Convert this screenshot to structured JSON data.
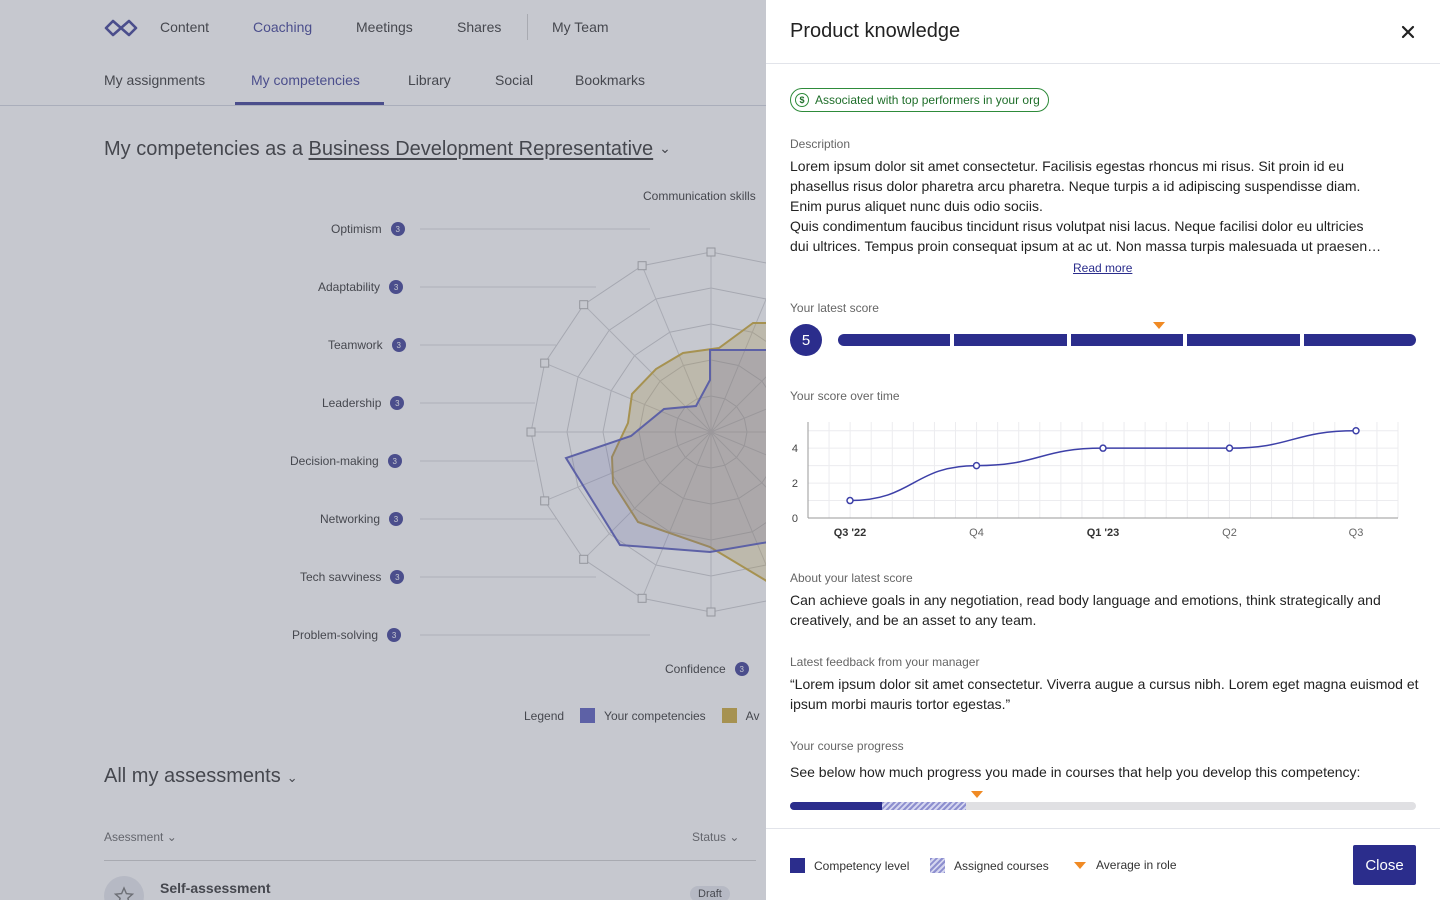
{
  "topnav": {
    "items": [
      "Content",
      "Coaching",
      "Meetings",
      "Shares",
      "My Team"
    ],
    "active": "Coaching"
  },
  "subnav": {
    "items": [
      "My assignments",
      "My competencies",
      "Library",
      "Social",
      "Bookmarks"
    ],
    "active": "My competencies"
  },
  "page": {
    "heading_prefix": "My competencies as a ",
    "role": "Business Development Representative"
  },
  "radar": {
    "competencies": [
      {
        "label": "Communication skills"
      },
      {
        "label": "Optimism",
        "badge": "3"
      },
      {
        "label": "Adaptability",
        "badge": "3"
      },
      {
        "label": "Teamwork",
        "badge": "3"
      },
      {
        "label": "Leadership",
        "badge": "3"
      },
      {
        "label": "Decision-making",
        "badge": "3"
      },
      {
        "label": "Networking",
        "badge": "3"
      },
      {
        "label": "Tech savviness",
        "badge": "3"
      },
      {
        "label": "Problem-solving",
        "badge": "3"
      },
      {
        "label": "Confidence",
        "badge": "3"
      }
    ],
    "legend_title": "Legend",
    "legend_items": [
      {
        "label": "Your competencies",
        "color": "#4b4fb8"
      },
      {
        "label": "Av",
        "color": "#c9a227"
      }
    ]
  },
  "assessments": {
    "heading": "All my assessments",
    "col_assessment": "Asessment",
    "col_status": "Status",
    "rows": [
      {
        "title": "Self-assessment",
        "status": "Draft"
      }
    ]
  },
  "drawer": {
    "title": "Product knowledge",
    "badge": "Associated with top performers in your org",
    "description_label": "Description",
    "description_lines": [
      "Lorem ipsum dolor sit amet consectetur. Facilisis egestas rhoncus mi risus. Sit proin id eu",
      "phasellus risus dolor pharetra arcu pharetra. Neque turpis a id adipiscing suspendisse diam.",
      "Enim purus aliquet nunc duis odio sociis.",
      "Quis condimentum faucibus tincidunt risus volutpat nisi lacus. Neque facilisi dolor eu ultricies",
      "dui ultrices. Tempus proin consequat ipsum at ac ut. Non massa turpis malesuada ut praesen…"
    ],
    "read_more": "Read more",
    "latest_score_label": "Your latest score",
    "latest_score": "5",
    "score_max_segments": 5,
    "average_marker_fraction": 0.555,
    "over_time_label": "Your score over time",
    "about_label": "About your latest score",
    "about_text": "Can achieve goals in any negotiation, read body language and emotions, think strategically and creatively, and be an asset to any team.",
    "feedback_label": "Latest feedback from your manager",
    "feedback_text": "“Lorem ipsum dolor sit amet consectetur. Viverra augue a cursus nibh. Lorem eget magna euismod et ipsum morbi mauris tortor egestas.”",
    "progress_label": "Your course progress",
    "progress_text": "See below how much progress you made in courses that help you develop this competency:",
    "progress": {
      "competency_level": 0.147,
      "assigned_courses_end": 0.281,
      "average_in_role": 0.298
    },
    "footer_legend": {
      "competency_level": "Competency level",
      "assigned_courses": "Assigned courses",
      "average_in_role": "Average in role"
    },
    "close_label": "Close"
  },
  "chart_data": {
    "type": "line",
    "title": "",
    "xlabel": "",
    "ylabel": "",
    "categories": [
      "Q3 '22",
      "Q4",
      "Q1 '23",
      "Q2",
      "Q3"
    ],
    "bold_categories": [
      "Q3 '22",
      "Q1 '23"
    ],
    "values": [
      1,
      3,
      4,
      4,
      5
    ],
    "yticks": [
      0,
      2,
      4
    ],
    "ylim": [
      0,
      5.5
    ],
    "grid": true,
    "color": "#3d40a8"
  },
  "colors": {
    "accent": "#2b2d8c",
    "average_marker": "#f08a24",
    "positive": "#2e8b3a"
  }
}
